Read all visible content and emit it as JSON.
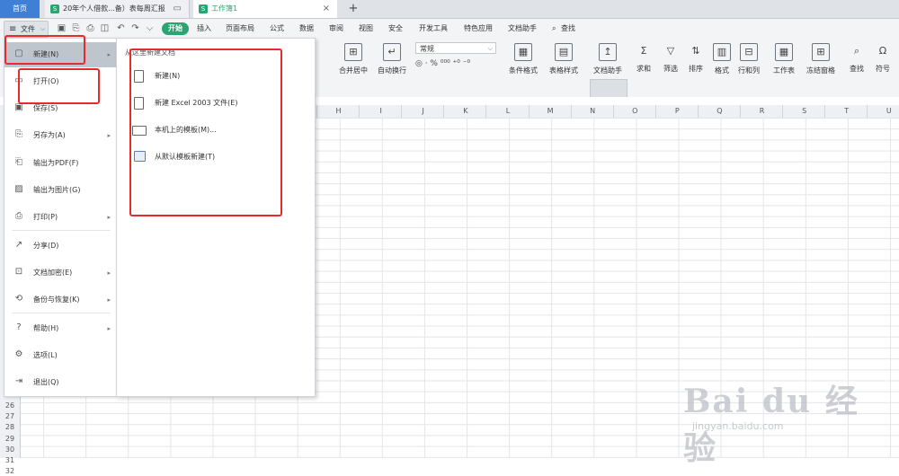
{
  "tabs": {
    "home": "首页",
    "doc1": "20年个人借款...备）表每周汇报",
    "doc2": "工作簿1",
    "doc_icon": "S",
    "close": "×",
    "add": "+"
  },
  "menubar": {
    "file": "文件",
    "start": "开始",
    "items": [
      "插入",
      "页面布局",
      "公式",
      "数据",
      "审阅",
      "视图",
      "安全",
      "开发工具",
      "特色应用",
      "文档助手",
      "查找"
    ]
  },
  "ribbon": {
    "merge": "合并居中",
    "wrap": "自动换行",
    "number_format": "常规",
    "num_symbols": "◎ · % ⁰⁰⁰ ⁺⁰ ⁻⁰",
    "cond_format": "条件格式",
    "table_style": "表格样式",
    "doc_helper": "文档助手",
    "sum": "求和",
    "filter": "筛选",
    "sort": "排序",
    "format": "格式",
    "rowcol": "行和列",
    "sheet": "工作表",
    "freeze": "冻结窗格",
    "find": "查找",
    "symbol": "符号"
  },
  "columns": [
    "H",
    "I",
    "J",
    "K",
    "L",
    "M",
    "N",
    "O",
    "P",
    "Q",
    "R",
    "S",
    "T",
    "U"
  ],
  "rows": [
    "26",
    "27",
    "28",
    "29",
    "30",
    "31",
    "32"
  ],
  "file_menu": [
    {
      "label": "新建(N)",
      "icon": "new-icon",
      "arrow": true
    },
    {
      "label": "打开(O)",
      "icon": "folder-icon",
      "arrow": false
    },
    {
      "label": "保存(S)",
      "icon": "save-icon",
      "arrow": false
    },
    {
      "label": "另存为(A)",
      "icon": "save-as-icon",
      "arrow": true
    },
    {
      "label": "输出为PDF(F)",
      "icon": "pdf-icon",
      "arrow": false
    },
    {
      "label": "输出为图片(G)",
      "icon": "image-icon",
      "arrow": false
    },
    {
      "label": "打印(P)",
      "icon": "print-icon",
      "arrow": true
    },
    {
      "label": "分享(D)",
      "icon": "share-icon",
      "arrow": false
    },
    {
      "label": "文档加密(E)",
      "icon": "encrypt-icon",
      "arrow": true
    },
    {
      "label": "备份与恢复(K)",
      "icon": "backup-icon",
      "arrow": true
    },
    {
      "label": "帮助(H)",
      "icon": "help-icon",
      "arrow": true
    },
    {
      "label": "选项(L)",
      "icon": "gear-icon",
      "arrow": false
    },
    {
      "label": "退出(Q)",
      "icon": "exit-icon",
      "arrow": false
    }
  ],
  "submenu": {
    "title": "从这里新建文档",
    "items": [
      {
        "label": "新建(N)",
        "icon": "blank-doc-icon"
      },
      {
        "label": "新建 Excel 2003 文件(E)",
        "icon": "blank-doc-icon"
      },
      {
        "label": "本机上的模板(M)...",
        "icon": "monitor-icon"
      },
      {
        "label": "从默认模板新建(T)",
        "icon": "template-icon"
      }
    ]
  },
  "watermark": {
    "main": "Bai du 经验",
    "sub": "jingyan.baidu.com"
  },
  "colors": {
    "accent_green": "#2ba471",
    "home_blue": "#3f7fd6",
    "annotation_red": "#e62b2b"
  }
}
